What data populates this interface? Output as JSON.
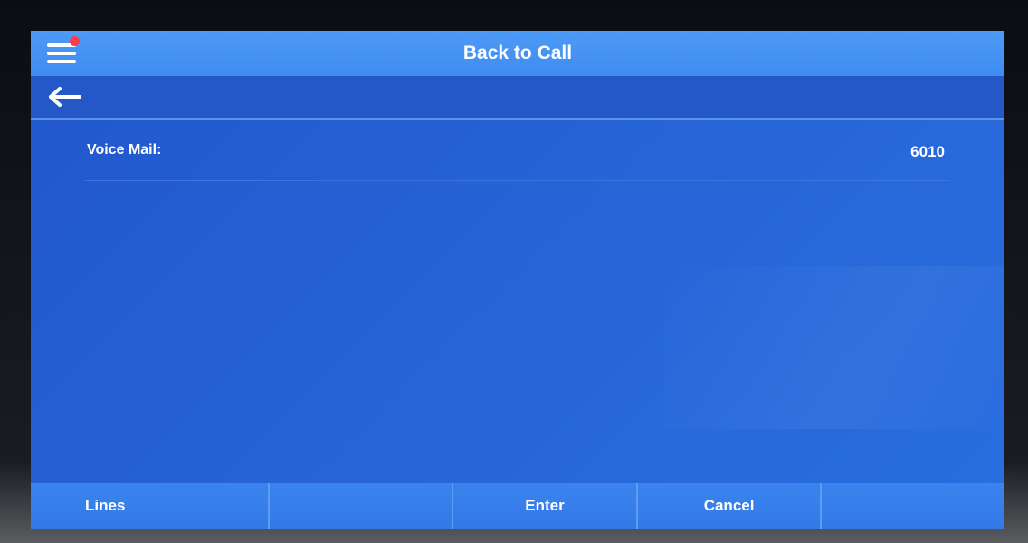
{
  "title_bar": {
    "title": "Back to Call",
    "menu_icon": "hamburger-menu-icon",
    "notification_color": "#ff3b4e"
  },
  "nav_bar": {
    "back_icon": "back-arrow-icon"
  },
  "settings_list": [
    {
      "label": "Voice Mail:",
      "value": "6010"
    }
  ],
  "softkeys": [
    "Lines",
    "",
    "Enter",
    "Cancel",
    ""
  ],
  "colors": {
    "title_bar": "#4d9af6",
    "screen_background": "#2563d6",
    "softkey_bar": "#3a84ee",
    "text": "#ffffff"
  }
}
